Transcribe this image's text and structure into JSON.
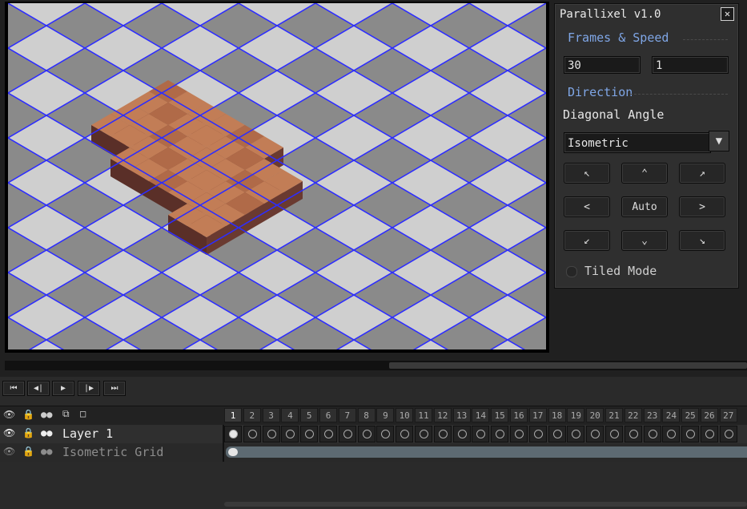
{
  "panel": {
    "title": "Parallixel v1.0",
    "close_icon": "close-icon",
    "frames_speed_heading": "Frames & Speed",
    "frames_value": "30",
    "speed_value": "1",
    "direction_heading": "Direction",
    "diagonal_angle_label": "Diagonal Angle",
    "angle_selected": "Isometric",
    "dir_buttons": {
      "up_left": "↖",
      "up": "⌃",
      "up_right": "↗",
      "left": "<",
      "auto": "Auto",
      "right": ">",
      "down_left": "↙",
      "down": "⌄",
      "down_right": "↘"
    },
    "tiled_mode_label": "Tiled Mode",
    "tiled_mode_checked": false
  },
  "playback": {
    "first_frame": "⏮",
    "prev_frame": "◀|",
    "play": "▶",
    "next_frame": "|▶",
    "last_frame": "⏭"
  },
  "timeline": {
    "frame_numbers": [
      "1",
      "2",
      "3",
      "4",
      "5",
      "6",
      "7",
      "8",
      "9",
      "10",
      "11",
      "12",
      "13",
      "14",
      "15",
      "16",
      "17",
      "18",
      "19",
      "20",
      "21",
      "22",
      "23",
      "24",
      "25",
      "26",
      "27"
    ],
    "layers": [
      {
        "name": "Layer 1",
        "active": true
      },
      {
        "name": "Isometric Grid",
        "active": false
      }
    ]
  },
  "colors": {
    "grid_line": "#2c2cff",
    "accent_heading": "#7fa6e6",
    "checker_light": "#cfcfcf",
    "checker_dark": "#8a8a8a",
    "tile_top": "#c27d56",
    "tile_side": "#6a3a30"
  }
}
